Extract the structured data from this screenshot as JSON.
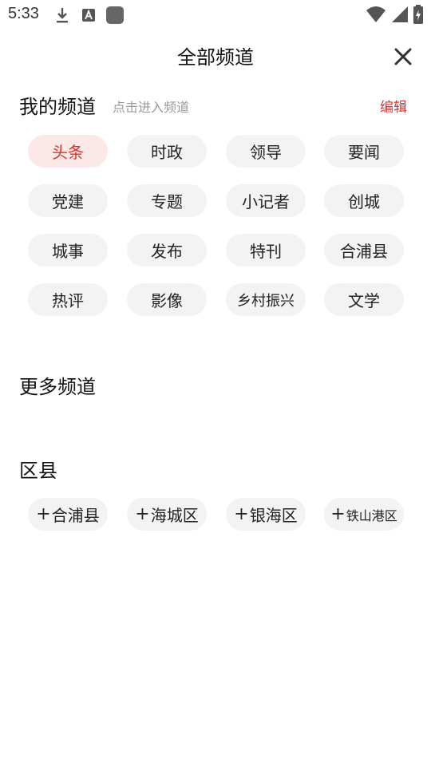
{
  "status_bar": {
    "time": "5:33"
  },
  "header": {
    "title": "全部频道",
    "close_icon": "close-icon"
  },
  "my_channels": {
    "title": "我的频道",
    "hint": "点击进入频道",
    "edit_label": "编辑",
    "items": [
      {
        "label": "头条",
        "active": true
      },
      {
        "label": "时政"
      },
      {
        "label": "领导"
      },
      {
        "label": "要闻"
      },
      {
        "label": "党建"
      },
      {
        "label": "专题"
      },
      {
        "label": "小记者"
      },
      {
        "label": "创城"
      },
      {
        "label": "城事"
      },
      {
        "label": "发布"
      },
      {
        "label": "特刊"
      },
      {
        "label": "合浦县"
      },
      {
        "label": "热评"
      },
      {
        "label": "影像"
      },
      {
        "label": "乡村振兴"
      },
      {
        "label": "文学"
      }
    ]
  },
  "more_channels": {
    "title": "更多频道"
  },
  "districts": {
    "title": "区县",
    "plus": "+",
    "items": [
      {
        "label": "合浦县"
      },
      {
        "label": "海城区"
      },
      {
        "label": "银海区"
      },
      {
        "label": "铁山港区"
      }
    ]
  },
  "colors": {
    "accent": "#e0302b",
    "active_bg": "#fde8e8",
    "chip_bg": "#f3f3f3"
  }
}
